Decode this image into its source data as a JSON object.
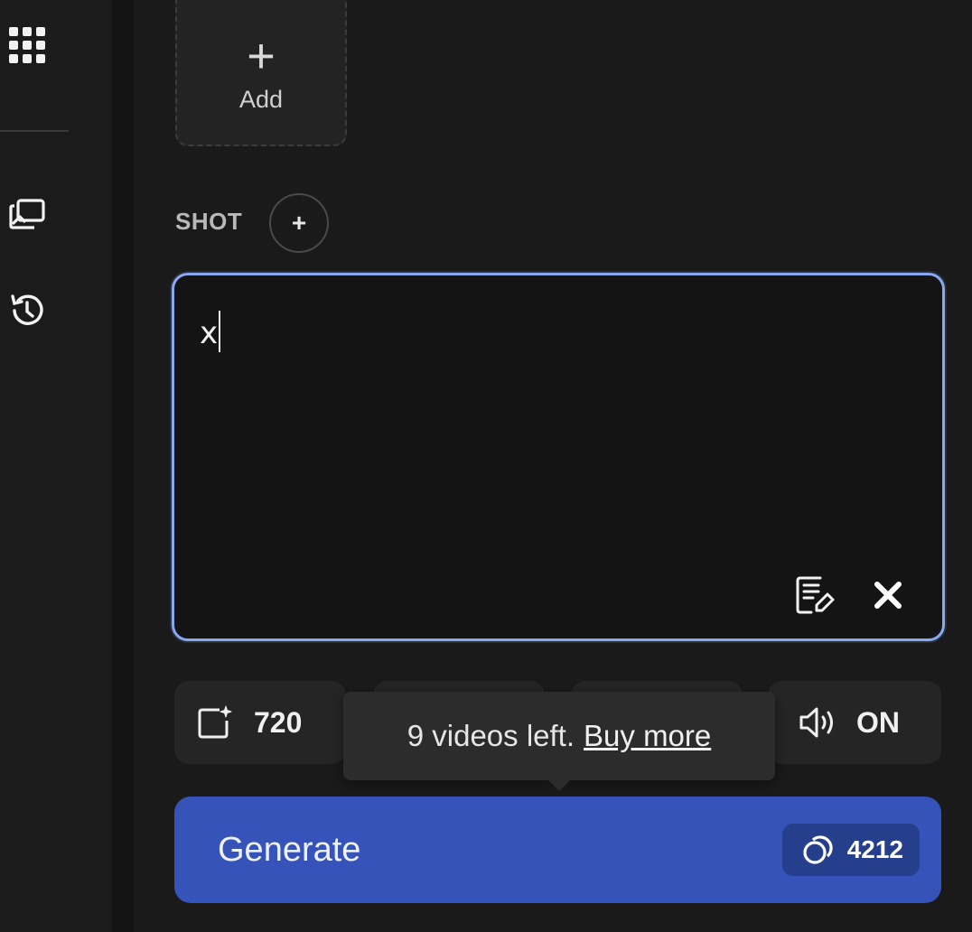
{
  "upload": {
    "add_label": "Add",
    "plus_glyph": "+"
  },
  "shot": {
    "label": "SHOT",
    "add_glyph": "+"
  },
  "prompt": {
    "value": "x"
  },
  "settings": {
    "resolution": {
      "icon": "sparkle-image-icon",
      "value": "720"
    },
    "audio": {
      "icon": "speaker-icon",
      "value": "ON"
    }
  },
  "tooltip": {
    "text": "9 videos left.",
    "link": "Buy more"
  },
  "generate": {
    "label": "Generate",
    "credits_icon": "coins-icon",
    "credits": "4212"
  },
  "colors": {
    "accent": "#8aa8f0",
    "generate_bg": "#3553b8",
    "credits_bg": "#263f8c",
    "background": "#1a1a1a"
  }
}
